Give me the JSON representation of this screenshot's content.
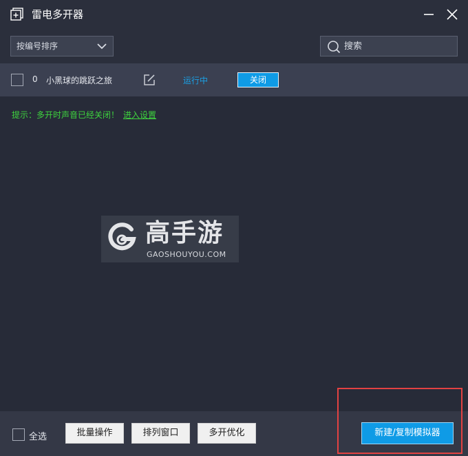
{
  "window": {
    "title": "雷电多开器",
    "icon": "add-window-icon",
    "minimize_icon": "minimize-icon",
    "close_icon": "close-icon"
  },
  "toolbar": {
    "sort_label": "按编号排序",
    "sort_icon": "chevron-down-icon",
    "search_placeholder": "搜索",
    "search_icon": "search-icon"
  },
  "instances": [
    {
      "index": "0",
      "name": "小黑球的跳跃之旅",
      "edit_icon": "edit-icon",
      "status": "运行中",
      "action_label": "关闭"
    }
  ],
  "notice": {
    "text": "提示：多开时声音已经关闭！",
    "link": "进入设置"
  },
  "watermark": {
    "cn": "高手游",
    "en": "GAOSHOUYOU.COM"
  },
  "footer": {
    "select_all": "全选",
    "batch_label": "批量操作",
    "arrange_label": "排列窗口",
    "optimize_label": "多开优化",
    "new_label": "新建/复制模拟器"
  },
  "colors": {
    "background": "#272b38",
    "accent": "#0f9be6",
    "status_running": "#1aa1e6",
    "notice": "#3ed33e",
    "highlight": "#e34242"
  }
}
